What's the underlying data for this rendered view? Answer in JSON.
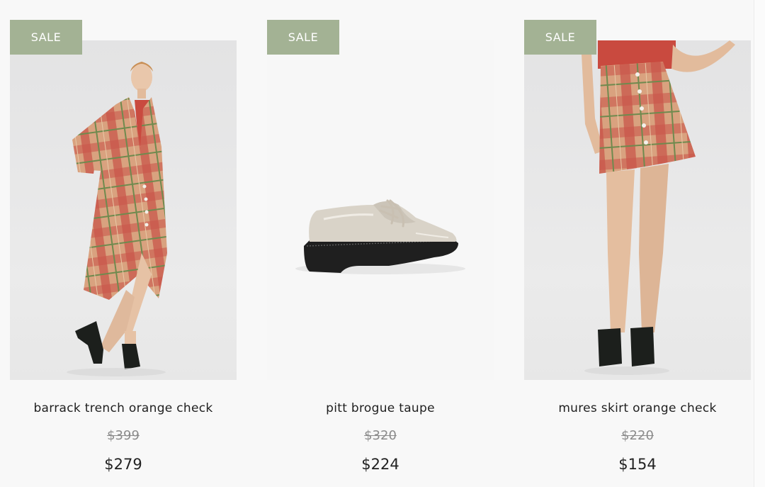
{
  "products": [
    {
      "badge": "SALE",
      "name": "barrack trench orange check",
      "original_price": "$399",
      "sale_price": "$279",
      "image": "model-wearing-plaid-trench-coat"
    },
    {
      "badge": "SALE",
      "name": "pitt brogue taupe",
      "original_price": "$320",
      "sale_price": "$224",
      "image": "taupe-patent-brogue-shoe"
    },
    {
      "badge": "SALE",
      "name": "mures skirt orange check",
      "original_price": "$220",
      "sale_price": "$154",
      "image": "model-wearing-plaid-skirt"
    }
  ],
  "colors": {
    "badge_bg": "#a3b294",
    "page_bg": "#f8f8f8",
    "plaid_base": "#d9a27f",
    "plaid_red": "#c9574b",
    "plaid_green": "#6f8a4e"
  }
}
